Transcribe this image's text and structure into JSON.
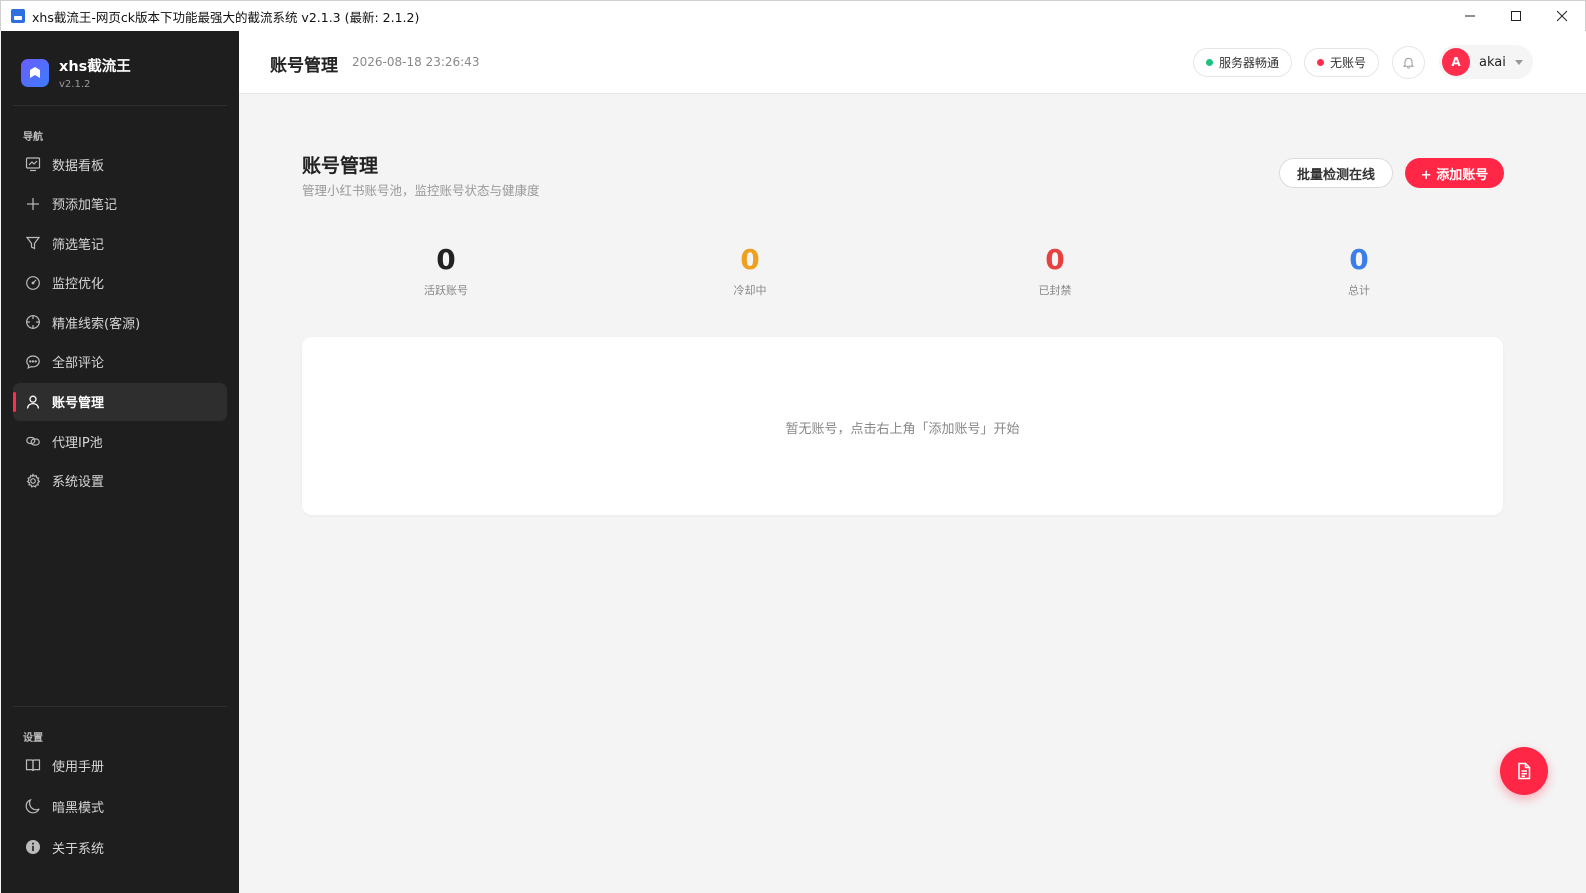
{
  "window": {
    "title": "xhs截流王-网页ck版本下功能最强大的截流系统 v2.1.3 (最新: 2.1.2)"
  },
  "brand": {
    "name": "xhs截流王",
    "version": "v2.1.2"
  },
  "sidebar": {
    "nav_label": "导航",
    "items": [
      {
        "label": "数据看板",
        "icon": "chart-icon"
      },
      {
        "label": "预添加笔记",
        "icon": "plus-icon"
      },
      {
        "label": "筛选笔记",
        "icon": "filter-icon"
      },
      {
        "label": "监控优化",
        "icon": "gauge-icon"
      },
      {
        "label": "精准线索(客源)",
        "icon": "crosshair-icon"
      },
      {
        "label": "全部评论",
        "icon": "comment-icon"
      },
      {
        "label": "账号管理",
        "icon": "user-icon"
      },
      {
        "label": "代理IP池",
        "icon": "link-icon"
      },
      {
        "label": "系统设置",
        "icon": "gear-icon"
      }
    ],
    "settings_label": "设置",
    "settings_items": [
      {
        "label": "使用手册",
        "icon": "book-icon"
      },
      {
        "label": "暗黑模式",
        "icon": "moon-icon"
      },
      {
        "label": "关于系统",
        "icon": "info-icon"
      }
    ]
  },
  "header": {
    "title": "账号管理",
    "datetime": "2026-08-18 23:26:43",
    "server_status": "服务器畅通",
    "account_status": "无账号",
    "user_initial": "A",
    "user_name": "akai"
  },
  "main": {
    "title": "账号管理",
    "subtitle": "管理小红书账号池，监控账号状态与健康度",
    "check_button": "批量检测在线",
    "add_button": "+ 添加账号",
    "stats": [
      {
        "value": "0",
        "label": "活跃账号",
        "color": "#222222"
      },
      {
        "value": "0",
        "label": "冷却中",
        "color": "#f0a020"
      },
      {
        "value": "0",
        "label": "已封禁",
        "color": "#e84040"
      },
      {
        "value": "0",
        "label": "总计",
        "color": "#3b7de9"
      }
    ],
    "empty_text": "暂无账号，点击右上角「添加账号」开始"
  },
  "colors": {
    "accent": "#ff2745",
    "server_ok": "#19c37d",
    "no_account": "#ff2e4d"
  }
}
